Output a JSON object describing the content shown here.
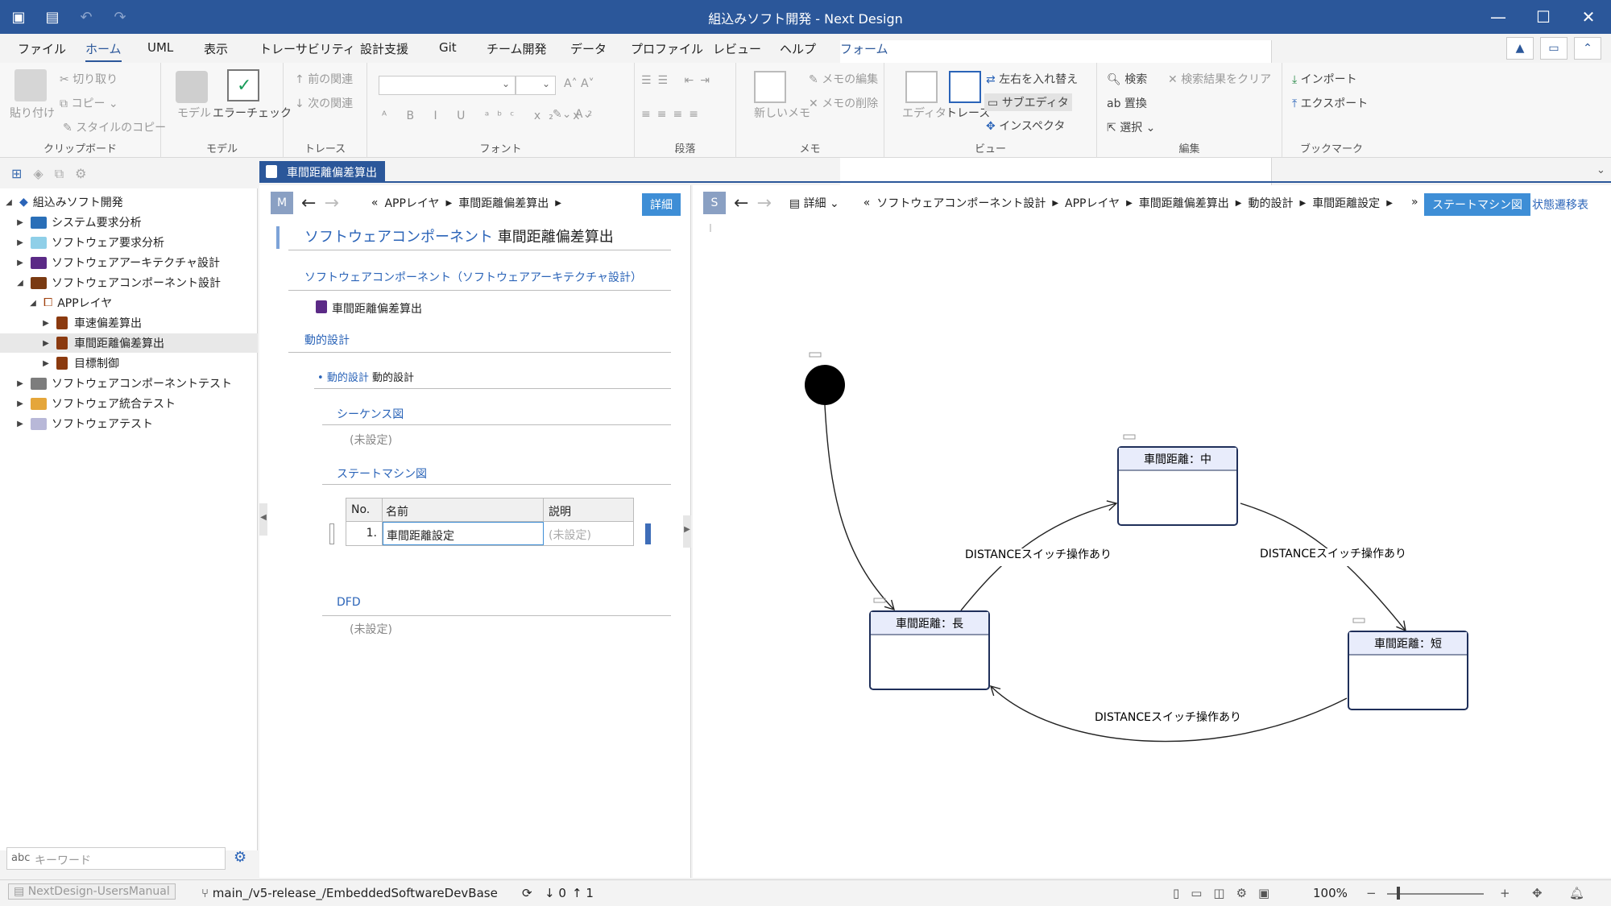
{
  "window": {
    "title": "組込みソフト開発 - Next Design"
  },
  "menu": {
    "tabs": [
      "ファイル",
      "ホーム",
      "UML",
      "表示",
      "トレーサビリティ",
      "設計支援",
      "Git",
      "チーム開発",
      "データ",
      "プロファイル",
      "レビュー",
      "ヘルプ",
      "フォーム"
    ]
  },
  "ribbon": {
    "clipboard": {
      "paste": "貼り付け",
      "cut": "切り取り",
      "copy": "コピー",
      "copy_style": "スタイルのコピー",
      "group": "クリップボード"
    },
    "model": {
      "model": "モデル",
      "error_check": "エラーチェック",
      "group": "モデル"
    },
    "trace": {
      "prev": "前の関連",
      "next": "次の関連",
      "group": "トレース"
    },
    "font": {
      "group": "フォント"
    },
    "paragraph": {
      "group": "段落"
    },
    "memo": {
      "new": "新しいメモ",
      "edit": "メモの編集",
      "delete": "メモの削除",
      "group": "メモ"
    },
    "view": {
      "editor": "エディタ",
      "trace": "トレース",
      "swap": "左右を入れ替え",
      "subeditor": "サブエディタ",
      "inspector": "インスペクタ",
      "group": "ビュー"
    },
    "edit": {
      "search": "検索",
      "clear": "検索結果をクリア",
      "replace": "置換",
      "select": "選択",
      "group": "編集"
    },
    "bookmark": {
      "import": "インポート",
      "export": "エクスポート",
      "group": "ブックマーク"
    }
  },
  "tree": {
    "items": [
      {
        "label": "組込みソフト開発"
      },
      {
        "label": "システム要求分析"
      },
      {
        "label": "ソフトウェア要求分析"
      },
      {
        "label": "ソフトウェアアーキテクチャ設計"
      },
      {
        "label": "ソフトウェアコンポーネント設計"
      },
      {
        "label": "APPレイヤ"
      },
      {
        "label": "車速偏差算出"
      },
      {
        "label": "車間距離偏差算出"
      },
      {
        "label": "目標制御"
      },
      {
        "label": "ソフトウェアコンポーネントテスト"
      },
      {
        "label": "ソフトウェア統合テスト"
      },
      {
        "label": "ソフトウェアテスト"
      }
    ],
    "keyword_placeholder": "キーワード"
  },
  "editor_tab": {
    "label": "車間距離偏差算出"
  },
  "form": {
    "badge": "M",
    "crumb_prefix": "«",
    "crumb1": "APPレイヤ",
    "crumb2": "車間距離偏差算出",
    "detail_button": "詳細",
    "title_type": "ソフトウェアコンポーネント",
    "title_name": "車間距離偏差算出",
    "section_component": "ソフトウェアコンポーネント（ソフトウェアアーキテクチャ設計）",
    "component_name": "車間距離偏差算出",
    "section_dynamic": "動的設計",
    "dynamic_link": "動的設計",
    "dynamic_name": "動的設計",
    "sequence": "シーケンス図",
    "unset": "(未設定)",
    "statemachine": "ステートマシン図",
    "grid_headers": [
      "No.",
      "名前",
      "説明"
    ],
    "grid_rows": [
      {
        "no": "1.",
        "name": "車間距離設定",
        "desc": "(未設定)"
      }
    ],
    "dfd": "DFD"
  },
  "diagram": {
    "badge": "S",
    "view_label": "詳細",
    "crumbs": [
      "«",
      "ソフトウェアコンポーネント設計",
      "APPレイヤ",
      "車間距離偏差算出",
      "動的設計",
      "車間距離設定"
    ],
    "more": "»",
    "button": "ステートマシン図",
    "link": "状態遷移表",
    "states": {
      "mid": "車間距離：中",
      "long": "車間距離：長",
      "short": "車間距離：短"
    },
    "transition_label": "DISTANCEスイッチ操作あり"
  },
  "status": {
    "user_manual": "NextDesign-UsersManual",
    "branch": "main_/v5-release_/EmbeddedSoftwareDevBase",
    "down": "0",
    "up": "1",
    "zoom": "100%"
  }
}
